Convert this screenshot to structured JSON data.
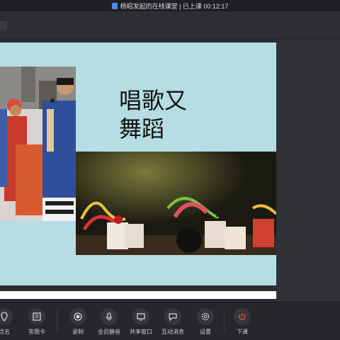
{
  "window": {
    "title": "杨昭发起的在线课堂 | 已上课 00:12:17"
  },
  "slide": {
    "heading_line1": "唱歌又",
    "heading_line2": "舞蹈"
  },
  "controls": [
    {
      "label": "点名",
      "icon": "pin-icon"
    },
    {
      "label": "答题卡",
      "icon": "answer-card-icon"
    },
    {
      "label": "录制",
      "icon": "record-icon"
    },
    {
      "label": "全员静音",
      "icon": "mute-all-icon"
    },
    {
      "label": "共享窗口",
      "icon": "share-window-icon"
    },
    {
      "label": "互动消息",
      "icon": "chat-icon"
    },
    {
      "label": "设置",
      "icon": "gear-icon"
    },
    {
      "label": "下课",
      "icon": "power-icon"
    }
  ],
  "colors": {
    "slide_bg": "#b5dde3",
    "accent": "#4a8df0",
    "leave": "#e5533d"
  }
}
